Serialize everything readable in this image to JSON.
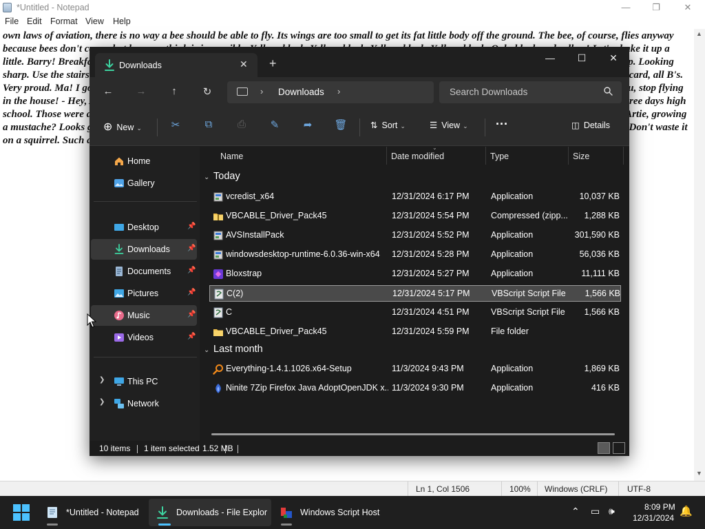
{
  "notepad": {
    "title": "*Untitled - Notepad",
    "menu": [
      "File",
      "Edit",
      "Format",
      "View",
      "Help"
    ],
    "text": "own laws of aviation, there is no way a bee should be able to fly. Its wings are too small to get its fat little body off the ground. The bee, of course, flies anyway because bees don't care what humans think is impossible. Yellow, black. Yellow, black. Yellow, black. Yellow, black. Ooh, black and yellow! Let's shake it up a little. Barry! Breakfast is ready! Coming! Hang on a second. Hello? - Barry? - Adam? - Can you believe this is happening? - I can't. I'll pick you up. Looking sharp. Use the stairs. Your father paid good money for those. Sorry. I'm excited. Here's the graduate. We're very proud of you, son. A perfect report card, all B's. Very proud. Ma! I got a thing going here. - You got lint on your fuzz. - Ow! That's me! - Wave to us! We'll be in row 118,000. - Bye! Barry, I told you, stop flying in the house! - Hey, Adam. - Hey, Barry. - Is that fuzz gel? - A little. Special day, graduation. Never thought I'd make it. Three days grade school, three days high school. Those were awkward. Three days college. I'm glad I took a day and hitchhiked around the hive. You did come back different. - Hi, Barry. - Artie, growing a mustache? Looks good. - Hear about Frankie? - Yeah. - You going to the funeral? - No, I'm not going. Everybody knows, sting someone, you die. Don't waste it on a squirrel. Such a hothead. I guess he could have just gotten out of the way. I love this incorporating an amusement park into our day.",
    "status": {
      "position": "Ln 1, Col 1506",
      "zoom": "100%",
      "line_ending": "Windows (CRLF)",
      "encoding": "UTF-8"
    }
  },
  "explorer": {
    "tab_label": "Downloads",
    "address": "Downloads",
    "search_placeholder": "Search Downloads",
    "toolbar": {
      "new_label": "New",
      "sort_label": "Sort",
      "view_label": "View",
      "details_label": "Details"
    },
    "nav": {
      "home": "Home",
      "gallery": "Gallery",
      "desktop": "Desktop",
      "downloads": "Downloads",
      "documents": "Documents",
      "pictures": "Pictures",
      "music": "Music",
      "videos": "Videos",
      "this_pc": "This PC",
      "network": "Network"
    },
    "columns": {
      "name": "Name",
      "date": "Date modified",
      "type": "Type",
      "size": "Size"
    },
    "groups": {
      "today": "Today",
      "last_month": "Last month"
    },
    "files": [
      {
        "name": "vcredist_x64",
        "date": "12/31/2024 6:17 PM",
        "type": "Application",
        "size": "10,037 KB",
        "icon": "installer-icon"
      },
      {
        "name": "VBCABLE_Driver_Pack45",
        "date": "12/31/2024 5:54 PM",
        "type": "Compressed (zipp...",
        "size": "1,288 KB",
        "icon": "zip-folder-icon"
      },
      {
        "name": "AVSInstallPack",
        "date": "12/31/2024 5:52 PM",
        "type": "Application",
        "size": "301,590 KB",
        "icon": "installer-icon"
      },
      {
        "name": "windowsdesktop-runtime-6.0.36-win-x64",
        "date": "12/31/2024 5:28 PM",
        "type": "Application",
        "size": "56,036 KB",
        "icon": "installer-icon"
      },
      {
        "name": "Bloxstrap",
        "date": "12/31/2024 5:27 PM",
        "type": "Application",
        "size": "11,111 KB",
        "icon": "bloxstrap-icon"
      },
      {
        "name": "C(2)",
        "date": "12/31/2024 5:17 PM",
        "type": "VBScript Script File",
        "size": "1,566 KB",
        "icon": "vbscript-icon"
      },
      {
        "name": "C",
        "date": "12/31/2024 4:51 PM",
        "type": "VBScript Script File",
        "size": "1,566 KB",
        "icon": "vbscript-icon"
      },
      {
        "name": "VBCABLE_Driver_Pack45",
        "date": "12/31/2024 5:59 PM",
        "type": "File folder",
        "size": "",
        "icon": "folder-icon"
      },
      {
        "name": "Everything-1.4.1.1026.x64-Setup",
        "date": "11/3/2024 9:43 PM",
        "type": "Application",
        "size": "1,869 KB",
        "icon": "everything-icon"
      },
      {
        "name": "Ninite 7Zip Firefox Java AdoptOpenJDK x...",
        "date": "11/3/2024 9:30 PM",
        "type": "Application",
        "size": "416 KB",
        "icon": "ninite-icon"
      }
    ],
    "status": {
      "item_count": "10 items",
      "selected": "1 item selected",
      "selected_size": "1.52 MB"
    }
  },
  "taskbar": {
    "apps": [
      {
        "label": "*Untitled - Notepad"
      },
      {
        "label": "Downloads - File Explor"
      },
      {
        "label": "Windows Script Host"
      }
    ],
    "time": "8:09 PM",
    "date": "12/31/2024"
  }
}
